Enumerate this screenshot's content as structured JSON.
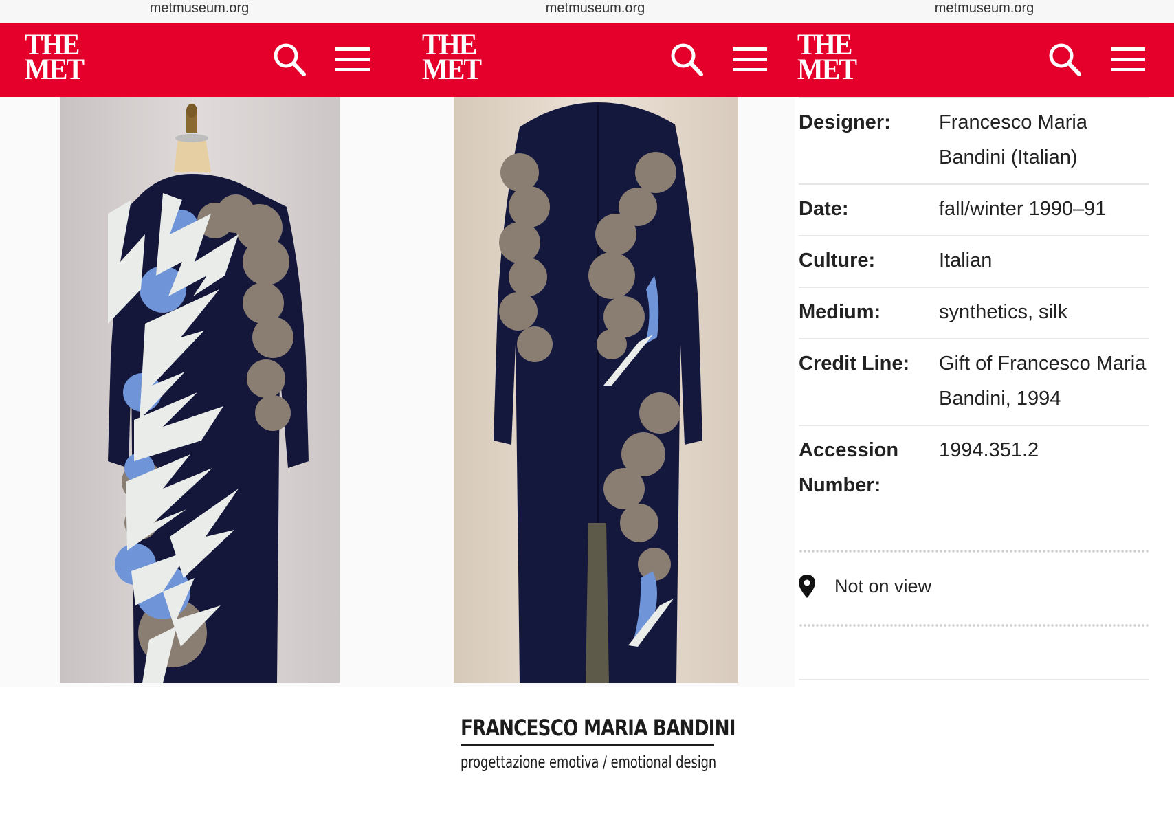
{
  "browser": {
    "url": "metmuseum.org"
  },
  "header": {
    "logo_line1": "THE",
    "logo_line2": "MET"
  },
  "icons": {
    "search": "search-icon",
    "menu": "hamburger-menu-icon",
    "location": "map-pin-icon"
  },
  "colors": {
    "brand_red": "#e4002b",
    "dress_navy": "#14173a",
    "patch_blue": "#6f95d8",
    "patch_grey": "#8a7d72",
    "patch_white": "#e9ece9"
  },
  "artwork": {
    "front_image": "Evening dress on dress form, front view",
    "back_image": "Evening dress on dress form, back view"
  },
  "details": [
    {
      "label": "Designer:",
      "value": "Francesco Maria Bandini (Italian)"
    },
    {
      "label": "Date:",
      "value": "fall/winter 1990–91"
    },
    {
      "label": "Culture:",
      "value": "Italian"
    },
    {
      "label": "Medium:",
      "value": "synthetics, silk"
    },
    {
      "label": "Credit Line:",
      "value": "Gift of Francesco Maria Bandini, 1994"
    },
    {
      "label": "Accession Number:",
      "value": "1994.351.2"
    }
  ],
  "location": {
    "status": "Not on view"
  },
  "caption": {
    "title": "FRANCESCO MARIA BANDINI",
    "subtitle": "progettazione emotiva / emotional design"
  }
}
